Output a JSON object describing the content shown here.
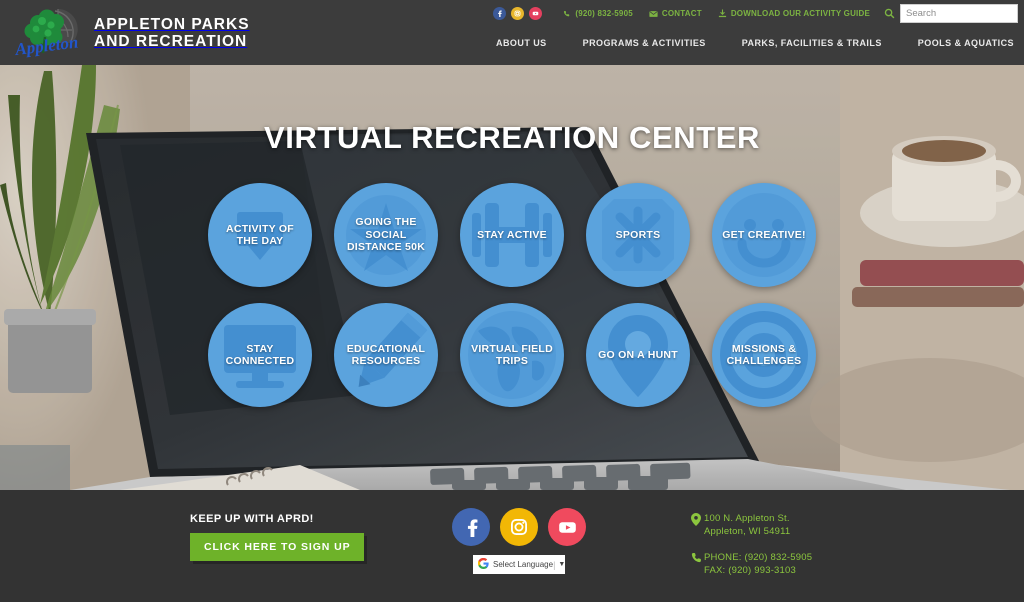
{
  "header": {
    "logo_icon": "appleton-tree-globe-logo",
    "site_title_line1": "APPLETON PARKS",
    "site_title_line2": "AND RECREATION",
    "social": [
      {
        "name": "facebook-icon",
        "color": "#3b5998"
      },
      {
        "name": "instagram-icon",
        "color": "#e8b62c"
      },
      {
        "name": "youtube-icon",
        "color": "#e4405f"
      }
    ],
    "util_links": [
      {
        "icon": "phone-icon",
        "label": "(920) 832-5905"
      },
      {
        "icon": "envelope-icon",
        "label": "CONTACT"
      },
      {
        "icon": "download-icon",
        "label": "DOWNLOAD OUR ACTIVITY GUIDE"
      }
    ],
    "search": {
      "icon": "search-icon",
      "placeholder": "Search",
      "value": ""
    },
    "nav": [
      {
        "label": "ABOUT US"
      },
      {
        "label": "PROGRAMS & ACTIVITIES"
      },
      {
        "label": "PARKS, FACILITIES & TRAILS"
      },
      {
        "label": "POOLS & AQUATICS"
      }
    ]
  },
  "hero": {
    "title": "VIRTUAL RECREATION CENTER",
    "background": "photo-laptop-on-desk-with-plant-and-coffee-cup",
    "circle_color": "#5ba3dd",
    "row1": [
      {
        "label": "ACTIVITY OF THE DAY",
        "icon": "calendar-icon"
      },
      {
        "label": "GOING THE SOCIAL DISTANCE 50K",
        "icon": "star-badge-icon"
      },
      {
        "label": "STAY ACTIVE",
        "icon": "dumbbell-icon"
      },
      {
        "label": "SPORTS",
        "icon": "crossed-sports-equipment-icon"
      },
      {
        "label": "GET CREATIVE!",
        "icon": "smiley-face-icon"
      }
    ],
    "row2": [
      {
        "label": "STAY CONNECTED",
        "icon": "monitor-icon"
      },
      {
        "label": "EDUCATIONAL RESOURCES",
        "icon": "pencil-icon"
      },
      {
        "label": "VIRTUAL FIELD TRIPS",
        "icon": "globe-icon"
      },
      {
        "label": "GO ON A HUNT",
        "icon": "map-pin-icon"
      },
      {
        "label": "MISSIONS & CHALLENGES",
        "icon": "target-bullseye-icon"
      }
    ]
  },
  "footer": {
    "keep_up_heading": "KEEP UP WITH APRD!",
    "signup_label": "CLICK HERE TO SIGN UP",
    "signup_color": "#6eb229",
    "social": [
      {
        "name": "facebook-icon",
        "color": "#4267b2"
      },
      {
        "name": "instagram-icon",
        "color": "#f2b705"
      },
      {
        "name": "youtube-icon",
        "color": "#f04a5e"
      }
    ],
    "language": {
      "icon": "google-g-icon",
      "label": "Select Language",
      "caret": "▼"
    },
    "address": {
      "icon": "map-pin-icon",
      "line1": "100 N. Appleton St.",
      "line2": "Appleton, WI 54911"
    },
    "phone": {
      "icon": "phone-icon",
      "line1": "PHONE: (920) 832-5905",
      "line2": "FAX: (920) 993-3103"
    }
  }
}
